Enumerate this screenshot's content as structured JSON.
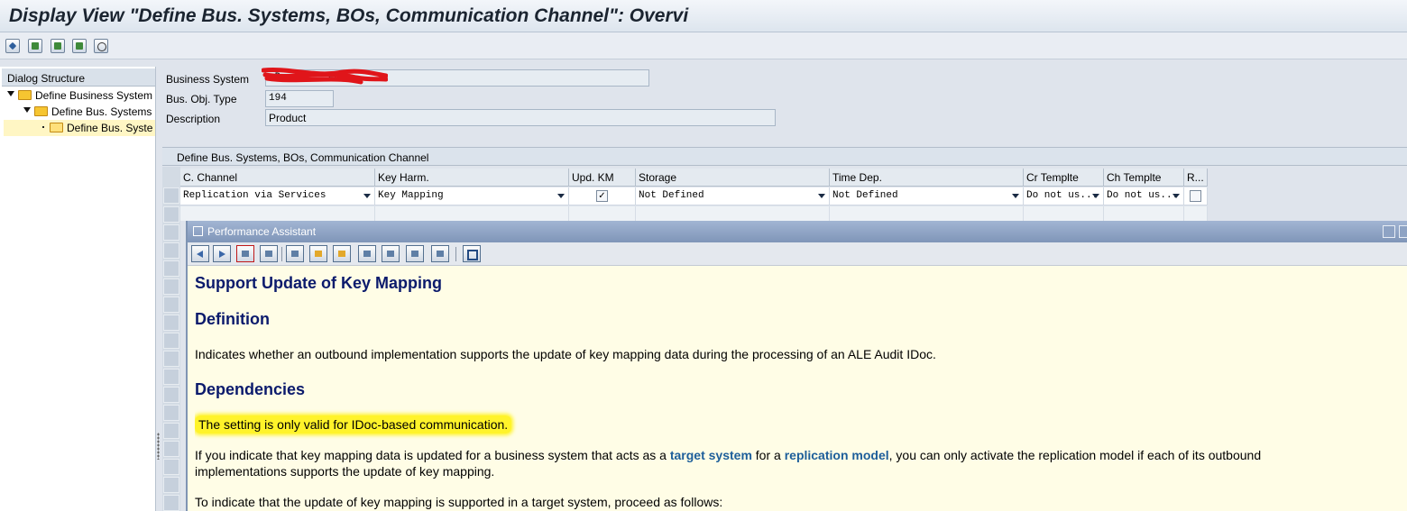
{
  "window": {
    "title": "Display View \"Define Bus. Systems, BOs, Communication Channel\": Overvi"
  },
  "toolbar": {
    "buttons": [
      "pencil-glasses-icon",
      "document-green-icon",
      "document-next-icon",
      "document-prev-icon",
      "glasses-icon"
    ]
  },
  "dialog_structure": {
    "header": "Dialog Structure",
    "items": [
      {
        "label": "Define Business System",
        "level": 0,
        "selected": false
      },
      {
        "label": "Define Bus. Systems",
        "level": 1,
        "selected": false
      },
      {
        "label": "Define Bus. Syste",
        "level": 2,
        "selected": true
      }
    ]
  },
  "form": {
    "business_system_label": "Business System",
    "business_system_value": "_D________em",
    "bo_type_label": "Bus. Obj. Type",
    "bo_type_value": "194",
    "description_label": "Description",
    "description_value": "Product"
  },
  "table": {
    "title": "Define Bus. Systems, BOs, Communication Channel",
    "columns": [
      "C. Channel",
      "Key Harm.",
      "Upd. KM",
      "Storage",
      "Time Dep.",
      "Cr Templte",
      "Ch Templte",
      "R..."
    ],
    "row": {
      "c_channel": "Replication via Services",
      "key_harm": "Key Mapping",
      "upd_km": "✓",
      "storage": "Not Defined",
      "time_dep": "Not Defined",
      "cr_templte": "Do not us...",
      "ch_templte": "Do not us...",
      "r": ""
    }
  },
  "performance_assistant": {
    "title": "Performance Assistant",
    "heading": "Support Update of Key Mapping",
    "definition_heading": "Definition",
    "definition_text": "Indicates whether an outbound implementation supports the update of key mapping data during the processing of an ALE Audit IDoc.",
    "dependencies_heading": "Dependencies",
    "dependency_highlight": "The setting is only valid for IDoc-based communication.",
    "para1_part1": "If you indicate that key mapping data is updated for a business system that acts as a ",
    "link_target_system": "target system",
    "para1_part2": " for a ",
    "link_replication_model": "replication model",
    "para1_part3": ", you can only activate the replication model if each of its outbound",
    "para1_line2": "implementations supports the update of key mapping.",
    "para2": "To indicate that the update of key mapping is supported in a target system, proceed as follows:"
  },
  "colors": {
    "heading_blue": "#0b1a6c",
    "link_blue": "#1d5e9a",
    "highlight_yellow": "#fff32a",
    "pa_background": "#fffde6",
    "redaction_red": "#e0151a"
  }
}
